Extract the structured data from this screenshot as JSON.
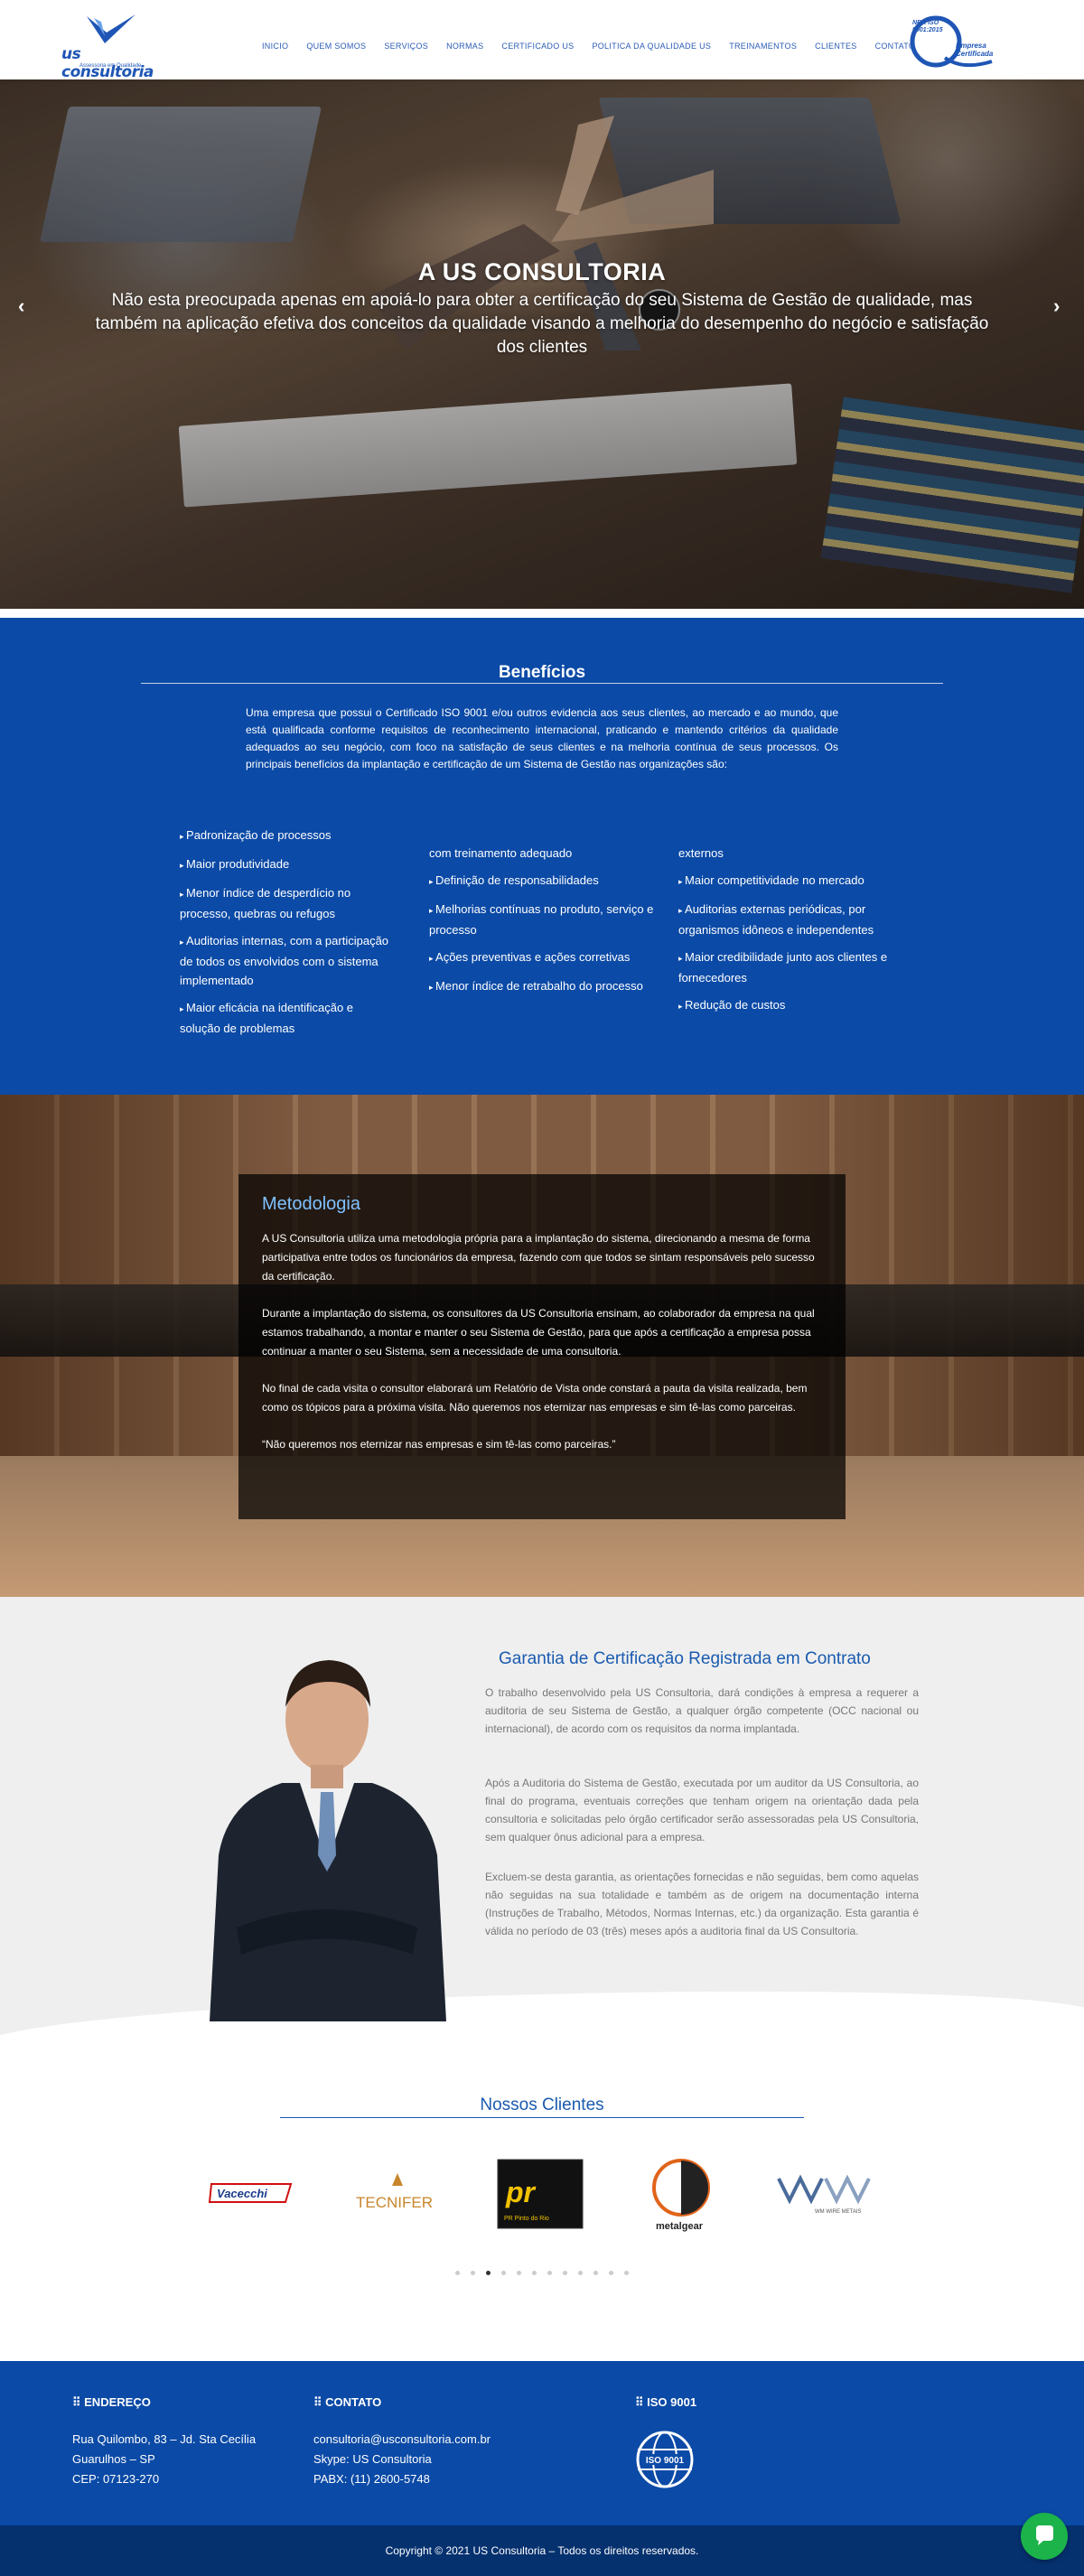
{
  "header": {
    "logo_text": "us consultoria",
    "logo_tagline": "Assessoria em Qualidade",
    "nav": [
      "INICIO",
      "QUEM SOMOS",
      "SERVIÇOS",
      "NORMAS",
      "CERTIFICADO US",
      "POLITICA DA QUALIDADE US",
      "TREINAMENTOS",
      "CLIENTES",
      "CONTATO"
    ],
    "seal_norm": "NBR ISO 9001:2015",
    "seal_text": "Empresa Certificada"
  },
  "hero": {
    "title": "A US CONSULTORIA",
    "text": "Não esta preocupada apenas em apoiá-lo para obter a certificação do seu Sistema de Gestão de qualidade, mas também na aplicação efetiva dos conceitos da qualidade visando a melhoria do desempenho do negócio e satisfação dos clientes",
    "prev": "‹",
    "next": "›"
  },
  "beneficios": {
    "title": "Benefícios",
    "intro": "Uma empresa que possui o Certificado ISO 9001 e/ou outros evidencia aos seus clientes, ao mercado e ao mundo, que está qualificada conforme requisitos de reconhecimento internacional, praticando e mantendo critérios da qualidade adequados ao seu negócio, com foco na satisfação de seus clientes e na melhoria contínua de seus processos. Os principais benefícios da implantação e certificação de um Sistema de Gestão nas organizações são:",
    "col1": [
      "Padronização de processos",
      "Maior produtividade",
      "Menor índice de desperdício no processo, quebras ou refugos",
      "Auditorias internas, com a participação de todos os envolvidos com o sistema implementado",
      "Maior eficácia na identificação e solução de problemas"
    ],
    "col2_cont": "com treinamento adequado",
    "col2": [
      "Definição de responsabilidades",
      "Melhorias contínuas no produto, serviço e processo",
      "Ações preventivas e ações corretivas",
      "Menor índice de retrabalho do processo"
    ],
    "col3_cont": "externos",
    "col3": [
      "Maior competitividade no mercado",
      "Auditorias externas periódicas, por organismos idôneos e independentes",
      "Maior credibilidade junto aos clientes e fornecedores",
      "Redução de custos"
    ]
  },
  "metodologia": {
    "title": "Metodologia",
    "p1": "A US Consultoria utiliza uma metodologia própria para a implantação do sistema, direcionando a mesma de forma participativa entre todos os funcionários da empresa, fazendo com que todos se sintam responsáveis pelo sucesso da certificação.",
    "p2": "Durante a implantação do sistema, os consultores da US Consultoria ensinam, ao colaborador da empresa na qual estamos trabalhando, a montar e manter o seu Sistema de Gestão, para que após a certificação a empresa possa continuar a manter o seu Sistema, sem a necessidade de uma consultoria.",
    "p3": "No final de cada visita o consultor elaborará um Relatório de Vista onde constará a pauta da visita realizada, bem como os tópicos para a próxima visita. Não queremos nos eternizar nas empresas e sim tê-las como parceiras.",
    "p4": "“Não queremos nos eternizar nas empresas e sim tê-las como parceiras.”"
  },
  "garantia": {
    "title": "Garantia de Certificação Registrada em Contrato",
    "p1": "O trabalho desenvolvido pela US Consultoria, dará condições à empresa a requerer a auditoria de seu Sistema de Gestão, a qualquer órgão competente (OCC nacional ou internacional), de acordo com os requisitos da norma implantada.",
    "p2": "Após a Auditoria do Sistema de Gestão, executada por um auditor da US Consultoria, ao final do programa, eventuais correções que tenham origem na orientação dada pela consultoria e solicitadas pelo órgão certificador serão assessoradas pela US Consultoria, sem qualquer ônus adicional para a empresa.",
    "p3": "Excluem-se desta garantia, as orientações fornecidas e não seguidas, bem como aquelas não seguidas na sua totalidade e também as de origem na documentação interna (Instruções de Trabalho, Métodos, Normas Internas, etc.) da organização. Esta garantia é válida no período de 03 (três) meses após a auditoria final da US Consultoria."
  },
  "clientes": {
    "title": "Nossos Clientes",
    "logos": [
      "Vacecchi",
      "TECNIFER",
      "PR Pinto do Rio",
      "metalgear",
      "WM WIRE METAIS"
    ],
    "dot_count": 12,
    "active_dot": 3
  },
  "footer": {
    "endereco_title": "ENDEREÇO",
    "endereco": [
      "Rua Quilombo, 83 – Jd. Sta Cecília",
      "Guarulhos – SP",
      "CEP: 07123-270"
    ],
    "contato_title": "CONTATO",
    "contato": [
      "consultoria@usconsultoria.com.br",
      "Skype: US Consultoria",
      "PABX: (11) 2600-5748"
    ],
    "iso_title": "ISO 9001",
    "iso_badge": "ISO 9001",
    "copyright": "Copyright © 2021 US Consultoria – Todos os direitos reservados."
  },
  "colors": {
    "brand_blue": "#0b4aa6",
    "dark_blue": "#06316f",
    "accent": "#1a5bb0",
    "chat_green": "#1cb34a"
  }
}
